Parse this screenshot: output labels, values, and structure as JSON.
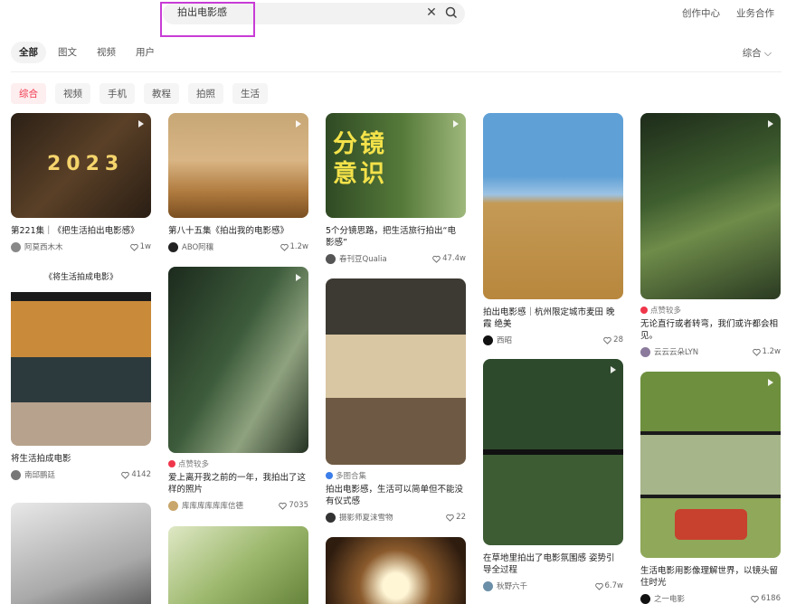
{
  "header": {
    "search_value": "拍出电影感",
    "creator_center": "创作中心",
    "business": "业务合作"
  },
  "tabs": [
    "全部",
    "图文",
    "视频",
    "用户"
  ],
  "sort_label": "综合",
  "chips": [
    "综合",
    "视频",
    "手机",
    "教程",
    "拍照",
    "生活"
  ],
  "cards": [
    {
      "title": "第221集｜《把生活拍出电影感》",
      "user": "阿莫西木木",
      "likes": "1w",
      "overlay": "2023"
    },
    {
      "title": "第八十五集《拍出我的电影感》",
      "user": "ABO阿穰",
      "likes": "1.2w"
    },
    {
      "title": "5个分镜思路，把生活旅行拍出“电影感”",
      "user": "春刊豆Qualia",
      "likes": "47.4w",
      "overlay": "分镜\n意识"
    },
    {
      "title": "拍出电影感｜杭州限定城市麦田 晚霞 绝美",
      "user": "西昭",
      "likes": "28"
    },
    {
      "tag": "点赞较多",
      "title": "无论直行或者转弯，我们或许都会相见。",
      "user": "云云云朵LYN",
      "likes": "1.2w"
    },
    {
      "title": "将生活拍成电影",
      "user": "南邱鹏廷",
      "likes": "4142",
      "overlay": "《将生活拍成电影》"
    },
    {
      "tag": "点赞较多",
      "title": "爱上离开我之前的一年，我拍出了这样的照片",
      "user": "库库库库库库信德",
      "likes": "7035"
    },
    {
      "tag": "多图合集",
      "title": "拍出电影感，生活可以简单但不能没有仪式感",
      "user": "摄影师夏沫雪物",
      "likes": "22"
    },
    {
      "title": "在草地里拍出了电影氛围感 姿势引导全过程",
      "user": "秋野六千",
      "likes": "6.7w"
    },
    {
      "title": "生活电影用影像理解世界，以镜头留住时光",
      "user": "之一电影",
      "likes": "6186"
    }
  ],
  "colors": {
    "accent": "#f0364b",
    "highlight": "#c83cd6"
  }
}
